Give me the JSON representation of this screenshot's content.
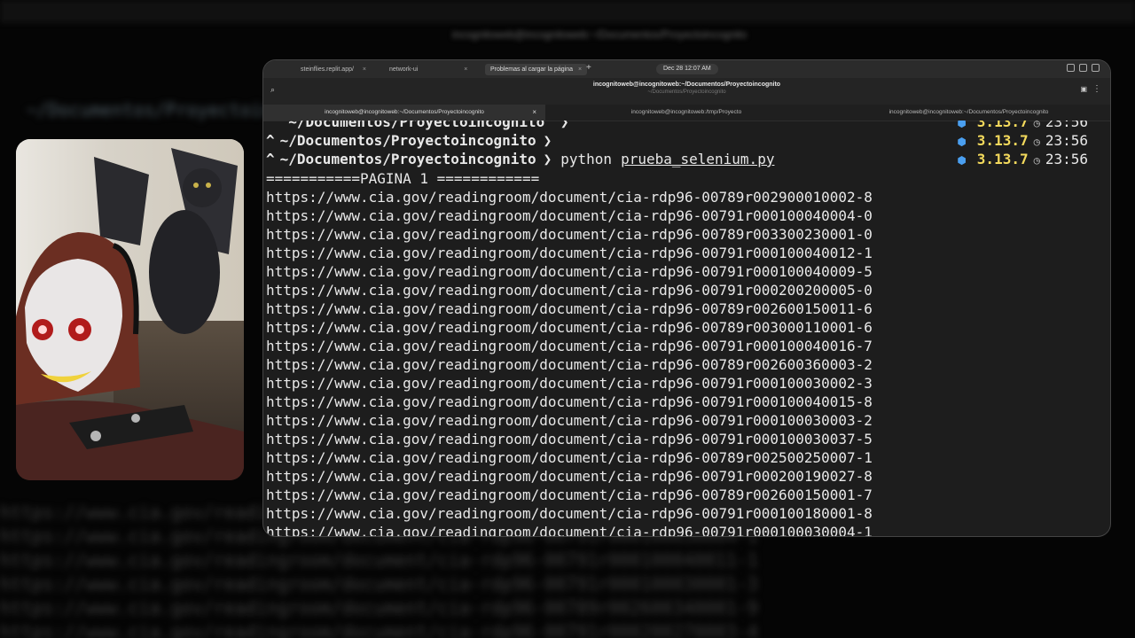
{
  "background": {
    "title": "incognitoweb@incognitoweb:~/Documentos/Proyectoincognito",
    "path": "~/Documentos/Proyectoincognito",
    "lines": [
      "https://www.cia.gov/readingroom/document/cia-rdp96-00791r000100180001-8",
      "https://www.cia.gov/readingroom/document/cia-rdp96-00791r000100030004-1",
      "https://www.cia.gov/readingroom/document/cia-rdp96-00791r000100040011-1",
      "https://www.cia.gov/readingroom/document/cia-rdp96-00791r000100030001-3",
      "https://www.cia.gov/readingroom/document/cia-rdp96-00789r002600340001-9",
      "https://www.cia.gov/readingroom/document/cia-rdp96-00791r000200270003-4"
    ]
  },
  "browser": {
    "tabs": [
      {
        "label": "steinflies.replit.app/",
        "close": "×"
      },
      {
        "label": "network-ui",
        "close": "×"
      },
      {
        "label": "Problemas al cargar la página",
        "close": "×"
      }
    ],
    "new_tab": "+",
    "clock": "Dec 28  12:07 AM"
  },
  "window": {
    "title": "incognitoweb@incognitoweb:~/Documentos/Proyectoincognito",
    "subtitle": "~/Documentos/Proyectoincognito",
    "search_icon": "search-icon",
    "menu_icon": "hamburger-menu-icon"
  },
  "terminal_tabs": [
    {
      "label": "incognitoweb@incognitoweb:~/Documentos/Proyectoincognito",
      "close": "×"
    },
    {
      "label": "incognitoweb@incognitoweb:/tmp/Proyecto"
    },
    {
      "label": "incognitoweb@incognitoweb:~/Documentos/Proyectoincognito"
    }
  ],
  "prompt": {
    "arrow": "^",
    "path": "~/Documentos/Proyectoincognito",
    "chevron": "❯",
    "command": "python",
    "argument": "prueba_selenium.py",
    "python_version": "3.13.7",
    "time": "23:56",
    "python_icon": "python-icon",
    "clock_icon": "clock-icon"
  },
  "output": {
    "header": "===========PAGINA 1 ============",
    "lines": [
      "https://www.cia.gov/readingroom/document/cia-rdp96-00789r002900010002-8",
      "https://www.cia.gov/readingroom/document/cia-rdp96-00791r000100040004-0",
      "https://www.cia.gov/readingroom/document/cia-rdp96-00789r003300230001-0",
      "https://www.cia.gov/readingroom/document/cia-rdp96-00791r000100040012-1",
      "https://www.cia.gov/readingroom/document/cia-rdp96-00791r000100040009-5",
      "https://www.cia.gov/readingroom/document/cia-rdp96-00791r000200200005-0",
      "https://www.cia.gov/readingroom/document/cia-rdp96-00789r002600150011-6",
      "https://www.cia.gov/readingroom/document/cia-rdp96-00789r003000110001-6",
      "https://www.cia.gov/readingroom/document/cia-rdp96-00791r000100040016-7",
      "https://www.cia.gov/readingroom/document/cia-rdp96-00789r002600360003-2",
      "https://www.cia.gov/readingroom/document/cia-rdp96-00791r000100030002-3",
      "https://www.cia.gov/readingroom/document/cia-rdp96-00791r000100040015-8",
      "https://www.cia.gov/readingroom/document/cia-rdp96-00791r000100030003-2",
      "https://www.cia.gov/readingroom/document/cia-rdp96-00791r000100030037-5",
      "https://www.cia.gov/readingroom/document/cia-rdp96-00789r002500250007-1",
      "https://www.cia.gov/readingroom/document/cia-rdp96-00791r000200190027-8",
      "https://www.cia.gov/readingroom/document/cia-rdp96-00789r002600150001-7",
      "https://www.cia.gov/readingroom/document/cia-rdp96-00791r000100180001-8",
      "https://www.cia.gov/readingroom/document/cia-rdp96-00791r000100030004-1"
    ]
  },
  "colors": {
    "version": "#f3d95c",
    "python_badge": "#4a9ff0",
    "terminal_bg": "#1d1d1d"
  }
}
